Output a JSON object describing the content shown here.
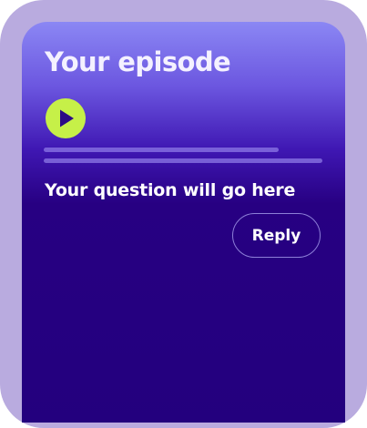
{
  "episode": {
    "title": "Your episode",
    "play_icon": "play-icon",
    "question": "Your question will go here",
    "reply_label": "Reply"
  },
  "colors": {
    "frame": "#b9abdf",
    "screen_top": "#8b87f4",
    "screen_bottom": "#23007e",
    "play_button": "#c6f048",
    "play_icon": "#2c0a86",
    "text": "#ffffff"
  }
}
